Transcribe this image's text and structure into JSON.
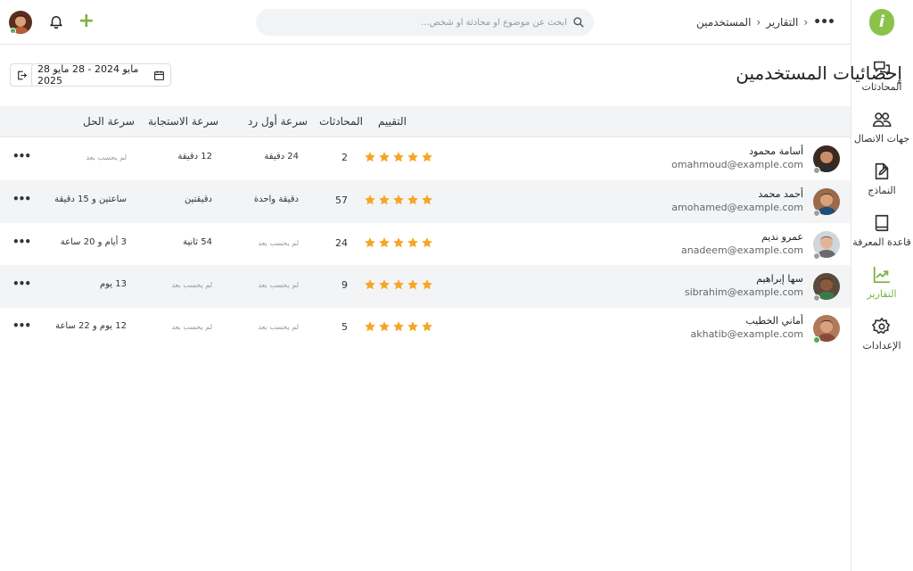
{
  "sidebar": {
    "items": [
      {
        "label": "المحادثات",
        "icon": "chat-bubbles-icon"
      },
      {
        "label": "جهات الاتصال",
        "icon": "contacts-icon"
      },
      {
        "label": "النماذج",
        "icon": "form-edit-icon"
      },
      {
        "label": "قاعدة المعرفة",
        "icon": "book-icon"
      },
      {
        "label": "التقارير",
        "icon": "chart-icon",
        "active": true
      },
      {
        "label": "الإعدادات",
        "icon": "gear-icon"
      }
    ],
    "accent": "#7cb342"
  },
  "breadcrumb": {
    "items": [
      "التقارير",
      "المستخدمين"
    ]
  },
  "search": {
    "placeholder": "ابحث عن موضوع أو محادثة أو شخص..."
  },
  "header": {
    "title": "إحصائيات المستخدمين",
    "date_range": "28 مايو 2024 - 28 مايو 2025"
  },
  "table": {
    "columns": {
      "rating": "التقييم",
      "conversations": "المحادثات",
      "first_response": "سرعة أول رد",
      "response": "سرعة الاستجابة",
      "solution": "سرعة الحل"
    },
    "rows": [
      {
        "name": "أسامة محمود",
        "email": "omahmoud@example.com",
        "status": "offline",
        "rating": 5,
        "conversations": "2",
        "first_response": "24 دقيقة",
        "response": "12 دقيقة",
        "solution": "لم يحسب بعد"
      },
      {
        "name": "أحمد محمد",
        "email": "amohamed@example.com",
        "status": "offline",
        "rating": 5,
        "conversations": "57",
        "first_response": "دقيقة واحدة",
        "response": "دقيقتين",
        "solution": "ساعتين و 15 دقيقة"
      },
      {
        "name": "عمرو نديم",
        "email": "anadeem@example.com",
        "status": "offline",
        "rating": 5,
        "conversations": "24",
        "first_response": "لم يحسب بعد",
        "response": "54 ثانية",
        "solution": "3 أيام و 20 ساعة"
      },
      {
        "name": "سها إبراهيم",
        "email": "sibrahim@example.com",
        "status": "offline",
        "rating": 5,
        "conversations": "9",
        "first_response": "لم يحسب بعد",
        "response": "لم يحسب بعد",
        "solution": "13 يوم"
      },
      {
        "name": "أماني الخطيب",
        "email": "akhatib@example.com",
        "status": "online",
        "rating": 5,
        "conversations": "5",
        "first_response": "لم يحسب بعد",
        "response": "لم يحسب بعد",
        "solution": "12 يوم و 22 ساعة"
      }
    ]
  },
  "colors": {
    "star": "#f5a623",
    "online": "#4caf50",
    "offline": "#9e9e9e",
    "row_alt": "#f3f4f6"
  }
}
